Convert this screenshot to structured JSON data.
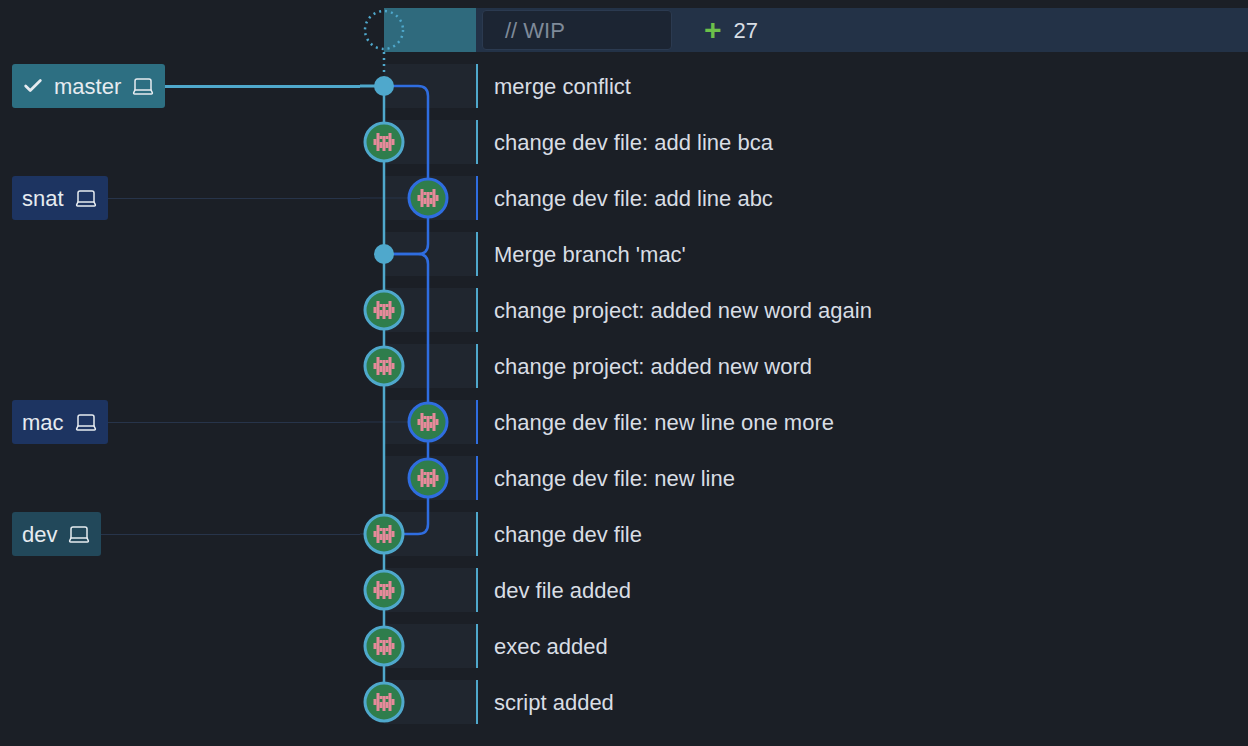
{
  "wip": {
    "placeholder": "// WIP",
    "added_icon": "+",
    "added_count": "27"
  },
  "commits": [
    {
      "message": "merge conflict",
      "lane": 0,
      "kind": "merge",
      "parents": [
        1,
        2
      ],
      "color": "#4fa8cc",
      "branch": {
        "name": "master",
        "current": true
      }
    },
    {
      "message": "change dev file: add line bca",
      "lane": 0,
      "kind": "commit",
      "parents": [
        3
      ],
      "color": "#4fa8cc",
      "branch": null
    },
    {
      "message": "change dev file: add line abc",
      "lane": 1,
      "kind": "commit",
      "parents": [
        3
      ],
      "color": "#2f6de0",
      "branch": {
        "name": "snat",
        "current": false
      }
    },
    {
      "message": "Merge branch 'mac'",
      "lane": 0,
      "kind": "merge",
      "parents": [
        4,
        6
      ],
      "color": "#4fa8cc",
      "branch": null
    },
    {
      "message": "change project: added new word again",
      "lane": 0,
      "kind": "commit",
      "parents": [
        5
      ],
      "color": "#4fa8cc",
      "branch": null
    },
    {
      "message": "change project: added new word",
      "lane": 0,
      "kind": "commit",
      "parents": [
        8
      ],
      "color": "#4fa8cc",
      "branch": null
    },
    {
      "message": "change dev file: new line one more",
      "lane": 1,
      "kind": "commit",
      "parents": [
        7
      ],
      "color": "#2f6de0",
      "branch": {
        "name": "mac",
        "current": false
      }
    },
    {
      "message": "change dev file: new line",
      "lane": 1,
      "kind": "commit",
      "parents": [
        8
      ],
      "color": "#2f6de0",
      "branch": null
    },
    {
      "message": "change dev file",
      "lane": 0,
      "kind": "commit",
      "parents": [
        9
      ],
      "color": "#4fa8cc",
      "branch": {
        "name": "dev",
        "current": false
      }
    },
    {
      "message": "dev file added",
      "lane": 0,
      "kind": "commit",
      "parents": [
        10
      ],
      "color": "#4fa8cc",
      "branch": null
    },
    {
      "message": "exec added",
      "lane": 0,
      "kind": "commit",
      "parents": [
        11
      ],
      "color": "#4fa8cc",
      "branch": null
    },
    {
      "message": "script added",
      "lane": 0,
      "kind": "commit",
      "parents": [],
      "color": "#4fa8cc",
      "branch": null
    }
  ]
}
